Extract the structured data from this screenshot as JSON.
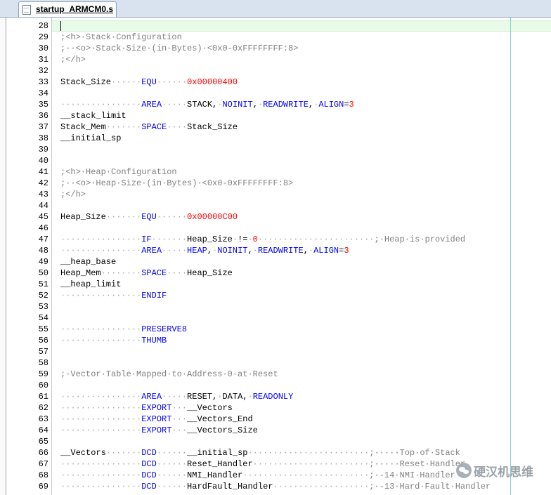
{
  "tab": {
    "label": "startup_ARMCM0.s"
  },
  "watermark": {
    "text": "硬汉机思维"
  },
  "colors": {
    "keyword": "#0000ff",
    "number": "#ff0000",
    "comment": "#808080",
    "whitespace_dot": "#a8a8a8",
    "current_line": "#e8fbe8",
    "edge_line": "#7fd6d6"
  },
  "lines": [
    {
      "n": "28",
      "t": ""
    },
    {
      "n": "29",
      "t": "{c};<h>·Stack·Configuration{/}"
    },
    {
      "n": "30",
      "t": "{c};··<o>·Stack·Size·(in·Bytes)·<0x0-0xFFFFFFFF:8>{/}"
    },
    {
      "n": "31",
      "t": "{c};</h>{/}"
    },
    {
      "n": "32",
      "t": ""
    },
    {
      "n": "33",
      "t": "Stack_Size······{k}EQU{/}······{n}0x00000400{/}"
    },
    {
      "n": "34",
      "t": ""
    },
    {
      "n": "35",
      "t": "················{k}AREA{/}·····STACK,·{k}NOINIT{/},·{k}READWRITE{/},·{k}ALIGN{/}={n}3{/}"
    },
    {
      "n": "36",
      "t": "__stack_limit"
    },
    {
      "n": "37",
      "t": "Stack_Mem·······{k}SPACE{/}····Stack_Size"
    },
    {
      "n": "38",
      "t": "__initial_sp"
    },
    {
      "n": "39",
      "t": ""
    },
    {
      "n": "40",
      "t": ""
    },
    {
      "n": "41",
      "t": "{c};<h>·Heap·Configuration{/}"
    },
    {
      "n": "42",
      "t": "{c};··<o>·Heap·Size·(in·Bytes)·<0x0-0xFFFFFFFF:8>{/}"
    },
    {
      "n": "43",
      "t": "{c};</h>{/}"
    },
    {
      "n": "44",
      "t": ""
    },
    {
      "n": "45",
      "t": "Heap_Size·······{k}EQU{/}······{n}0x00000C00{/}"
    },
    {
      "n": "46",
      "t": ""
    },
    {
      "n": "47",
      "t": "················{k}IF{/}·······Heap_Size·!=·{n}0{/}·······················{c};·Heap·is·provided{/}"
    },
    {
      "n": "48",
      "t": "················{k}AREA{/}·····{k}HEAP{/},·{k}NOINIT{/},·{k}READWRITE{/},·{k}ALIGN{/}={n}3{/}"
    },
    {
      "n": "49",
      "t": "__heap_base"
    },
    {
      "n": "50",
      "t": "Heap_Mem········{k}SPACE{/}····Heap_Size"
    },
    {
      "n": "51",
      "t": "__heap_limit"
    },
    {
      "n": "52",
      "t": "················{k}ENDIF{/}"
    },
    {
      "n": "53",
      "t": ""
    },
    {
      "n": "54",
      "t": ""
    },
    {
      "n": "55",
      "t": "················{k}PRESERVE8{/}"
    },
    {
      "n": "56",
      "t": "················{k}THUMB{/}"
    },
    {
      "n": "57",
      "t": ""
    },
    {
      "n": "58",
      "t": ""
    },
    {
      "n": "59",
      "t": "{c};·Vector·Table·Mapped·to·Address·0·at·Reset{/}"
    },
    {
      "n": "60",
      "t": ""
    },
    {
      "n": "61",
      "t": "················{k}AREA{/}·····RESET,·DATA,·{k}READONLY{/}"
    },
    {
      "n": "62",
      "t": "················{k}EXPORT{/}···__Vectors"
    },
    {
      "n": "63",
      "t": "················{k}EXPORT{/}···__Vectors_End"
    },
    {
      "n": "64",
      "t": "················{k}EXPORT{/}···__Vectors_Size"
    },
    {
      "n": "65",
      "t": ""
    },
    {
      "n": "66",
      "t": "__Vectors·······{k}DCD{/}······__initial_sp························{c};·····Top·of·Stack{/}"
    },
    {
      "n": "67",
      "t": "················{k}DCD{/}······Reset_Handler·······················{c};·····Reset·Handler{/}"
    },
    {
      "n": "68",
      "t": "················{k}DCD{/}······NMI_Handler·························{c};·-14·NMI·Handler{/}"
    },
    {
      "n": "69",
      "t": "················{k}DCD{/}······HardFault_Handler···················{c};·-13·Hard·Fault·Handler{/}"
    }
  ]
}
